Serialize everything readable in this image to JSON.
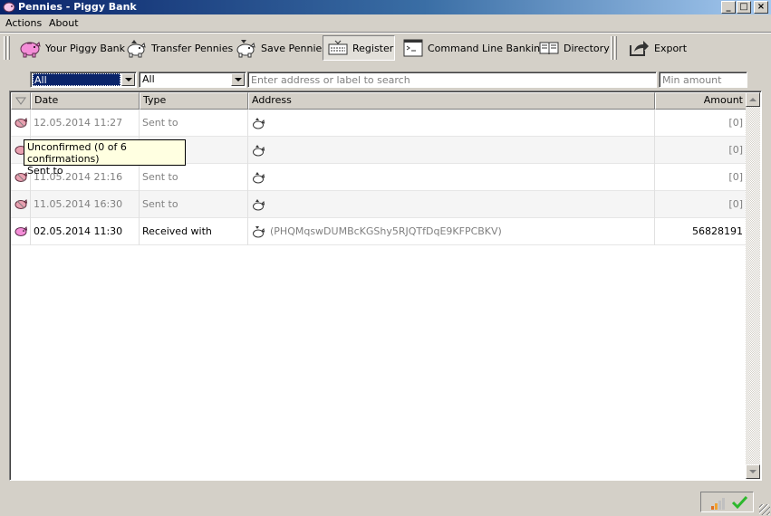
{
  "window": {
    "title": "Pennies - Piggy Bank",
    "buttons": {
      "minimize": "_",
      "maximize": "□",
      "close": "×"
    }
  },
  "menu": [
    {
      "label": "Actions"
    },
    {
      "label": "About"
    }
  ],
  "toolbar": {
    "items": [
      {
        "label": "Your Piggy Bank",
        "icon": "piggy-bank-icon"
      },
      {
        "label": "Transfer Pennies",
        "icon": "piggy-send-icon"
      },
      {
        "label": "Save Pennies",
        "icon": "piggy-receive-icon"
      },
      {
        "label": "Register",
        "icon": "register-icon",
        "active": true
      },
      {
        "label": "Command Line Banking",
        "icon": "console-icon"
      },
      {
        "label": "Directory",
        "icon": "book-icon"
      },
      {
        "label": "Export",
        "icon": "export-icon"
      }
    ]
  },
  "filters": {
    "date_range": "All",
    "type": "All",
    "search_placeholder": "Enter address or label to search",
    "min_amount_placeholder": "Min amount"
  },
  "table": {
    "columns": [
      "Date",
      "Type",
      "Address",
      "Amount"
    ],
    "rows": [
      {
        "date": "12.05.2014 11:27",
        "type": "Sent to",
        "address": "",
        "amount": "[0]",
        "status": "unconfirmed"
      },
      {
        "date": "",
        "type": "",
        "address": "",
        "amount": "[0]",
        "status": "unconfirmed"
      },
      {
        "date": "11.05.2014 21:16",
        "type": "Sent to",
        "address": "",
        "amount": "[0]",
        "status": "unconfirmed"
      },
      {
        "date": "11.05.2014 16:30",
        "type": "Sent to",
        "address": "",
        "amount": "[0]",
        "status": "unconfirmed"
      },
      {
        "date": "02.05.2014 11:30",
        "type": "Received with",
        "address": "(PHQMqswDUMBcKGShy5RJQTfDqE9KFPCBKV)",
        "amount": "56828191",
        "status": "confirmed"
      }
    ]
  },
  "tooltip": {
    "line1": "Unconfirmed (0 of 6 confirmations)",
    "line2": "Sent to"
  },
  "colors": {
    "title_gradient_start": "#0a246a",
    "title_gradient_end": "#a6caf0",
    "piggy_pink": "#f48ed8",
    "check_green": "#2db82d"
  }
}
